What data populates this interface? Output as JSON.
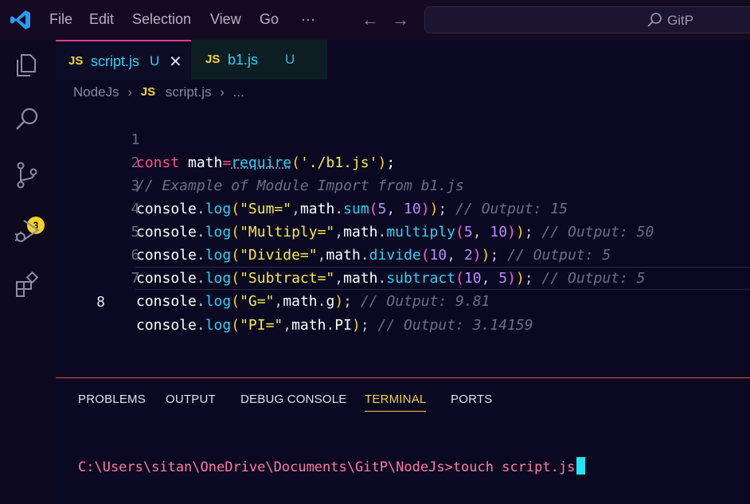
{
  "titlebar": {
    "menu": [
      "File",
      "Edit",
      "Selection",
      "View",
      "Go",
      "···"
    ],
    "search_placeholder": "GitP"
  },
  "activity": {
    "source_control_badge": "3",
    "icons": [
      "explorer-icon",
      "search-icon",
      "source-control-icon",
      "run-debug-icon",
      "extensions-icon"
    ]
  },
  "tabs": [
    {
      "lang": "JS",
      "label": "script.js",
      "status": "U",
      "active": true
    },
    {
      "lang": "JS",
      "label": "b1.js",
      "status": "U",
      "active": false
    }
  ],
  "breadcrumb": {
    "folder": "NodeJs",
    "lang": "JS",
    "file": "script.js",
    "more": "..."
  },
  "editor": {
    "current_line": 8,
    "lines": [
      {
        "n": "1"
      },
      {
        "n": "2"
      },
      {
        "n": "3"
      },
      {
        "n": "4"
      },
      {
        "n": "5"
      },
      {
        "n": "6"
      },
      {
        "n": "7"
      },
      {
        "n": "8"
      }
    ]
  },
  "code": {
    "l1": {
      "kw": "const",
      "var": "math",
      "op": "=",
      "fn": "require",
      "open": "(",
      "str": "'./b1.js'",
      "close": ")",
      "semi": ";"
    },
    "l2": {
      "comment": "// Example of Module Import from b1.js"
    },
    "l3": {
      "obj": "console",
      "fn": "log",
      "str": "\"Sum=\"",
      "mod": "math",
      "method": "sum",
      "a": "5",
      "b": "10",
      "comment": "// Output: 15"
    },
    "l4": {
      "obj": "console",
      "fn": "log",
      "str": "\"Multiply=\"",
      "mod": "math",
      "method": "multiply",
      "a": "5",
      "b": "10",
      "comment": "// Output: 50"
    },
    "l5": {
      "obj": "console",
      "fn": "log",
      "str": "\"Divide=\"",
      "mod": "math",
      "method": "divide",
      "a": "10",
      "b": "2",
      "comment": "// Output: 5"
    },
    "l6": {
      "obj": "console",
      "fn": "log",
      "str": "\"Subtract=\"",
      "mod": "math",
      "method": "subtract",
      "a": "10",
      "b": "5",
      "comment": "// Output: 5"
    },
    "l7": {
      "obj": "console",
      "fn": "log",
      "str": "\"G=\"",
      "mod": "math",
      "prop": "g",
      "comment": "// Output: 9.81"
    },
    "l8": {
      "obj": "console",
      "fn": "log",
      "str": "\"PI=\"",
      "mod": "math",
      "prop": "PI",
      "comment": "// Output: 3.14159"
    }
  },
  "panel": {
    "tabs": [
      "PROBLEMS",
      "OUTPUT",
      "DEBUG CONSOLE",
      "TERMINAL",
      "PORTS"
    ],
    "active_tab": "TERMINAL",
    "terminal_prompt": "C:\\Users\\sitan\\OneDrive\\Documents\\GitP\\NodeJs>",
    "terminal_command": "touch script.js"
  },
  "colors": {
    "keyword": "#ff4f8b",
    "function": "#2bd3f5",
    "string": "#f5ea4a",
    "number": "#b98cff",
    "comment": "#6f6b8c",
    "accent_tab": "#e83b8b",
    "terminal_text": "#ff7aa4",
    "cursor": "#21e5f5"
  }
}
